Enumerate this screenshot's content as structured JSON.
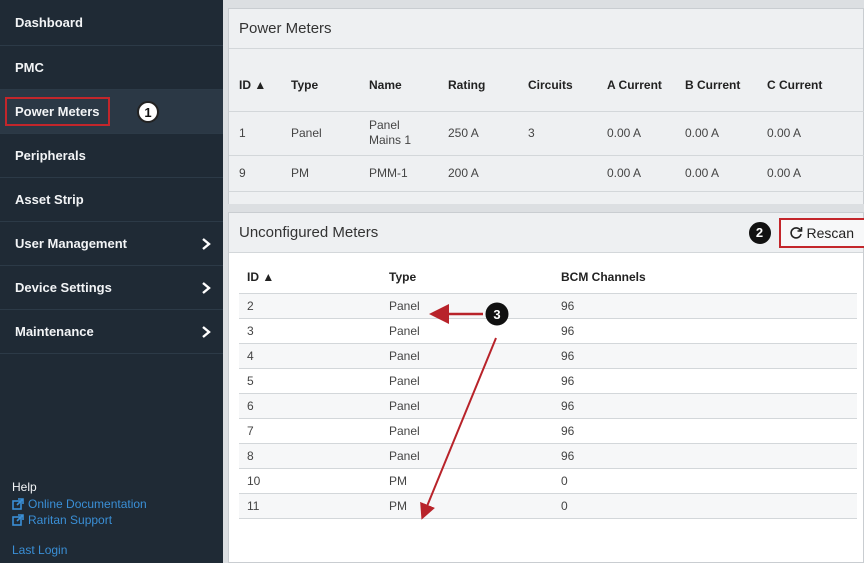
{
  "sidebar": {
    "items": [
      {
        "label": "Dashboard",
        "chevron": false
      },
      {
        "label": "PMC",
        "chevron": false
      },
      {
        "label": "Power Meters",
        "chevron": false,
        "active": true
      },
      {
        "label": "Peripherals",
        "chevron": false
      },
      {
        "label": "Asset Strip",
        "chevron": false
      },
      {
        "label": "User Management",
        "chevron": true
      },
      {
        "label": "Device Settings",
        "chevron": true
      },
      {
        "label": "Maintenance",
        "chevron": true
      }
    ],
    "help_title": "Help",
    "online_docs": "Online Documentation",
    "raritan_support": "Raritan Support",
    "last_login": "Last Login"
  },
  "callouts": {
    "one": "1",
    "two": "2",
    "three": "3"
  },
  "power_meters": {
    "title": "Power Meters",
    "columns": [
      "ID ▲",
      "Type",
      "Name",
      "Rating",
      "Circuits",
      "A Current",
      "B Current",
      "C Current"
    ],
    "rows": [
      [
        "1",
        "Panel",
        "Panel Mains 1",
        "250 A",
        "3",
        "0.00 A",
        "0.00 A",
        "0.00 A"
      ],
      [
        "9",
        "PM",
        "PMM-1",
        "200 A",
        "",
        "0.00 A",
        "0.00 A",
        "0.00 A"
      ]
    ]
  },
  "unconfigured": {
    "title": "Unconfigured Meters",
    "rescan_label": "Rescan",
    "columns": [
      "ID ▲",
      "Type",
      "BCM Channels"
    ],
    "rows": [
      [
        "2",
        "Panel",
        "96"
      ],
      [
        "3",
        "Panel",
        "96"
      ],
      [
        "4",
        "Panel",
        "96"
      ],
      [
        "5",
        "Panel",
        "96"
      ],
      [
        "6",
        "Panel",
        "96"
      ],
      [
        "7",
        "Panel",
        "96"
      ],
      [
        "8",
        "Panel",
        "96"
      ],
      [
        "10",
        "PM",
        "0"
      ],
      [
        "11",
        "PM",
        "0"
      ]
    ]
  },
  "colors": {
    "sidebar_bg": "#1f2a35",
    "link": "#3a8fd6",
    "highlight": "#c3262b",
    "arrow": "#b8232a"
  }
}
